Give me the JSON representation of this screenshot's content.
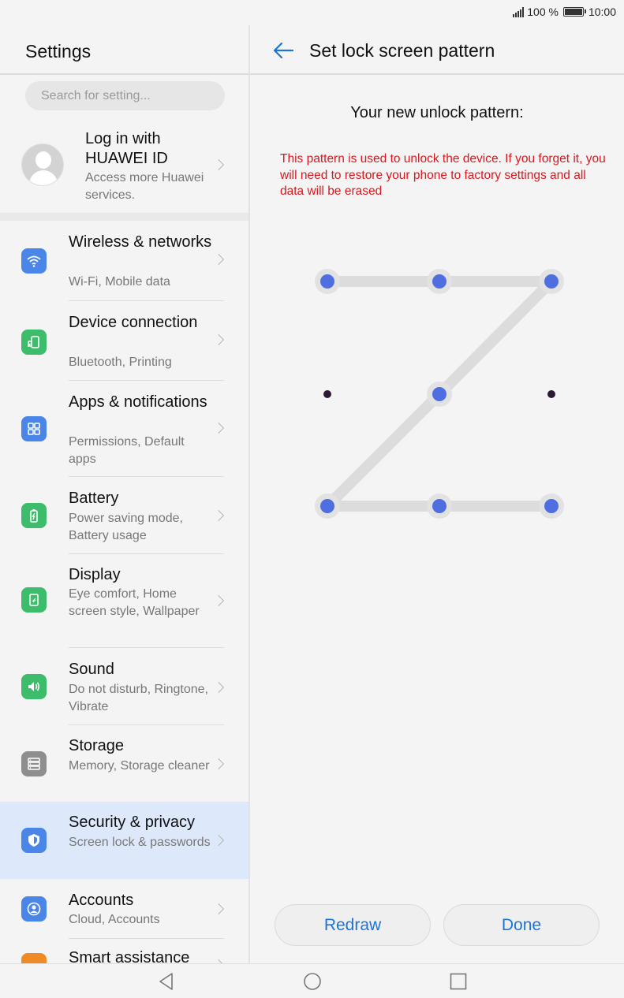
{
  "status_bar": {
    "battery_percent": "100 %",
    "time": "10:00"
  },
  "left": {
    "title": "Settings",
    "search_placeholder": "Search for setting...",
    "account": {
      "title": "Log in with HUAWEI ID",
      "subtitle": "Access more Huawei services."
    },
    "items": [
      {
        "title": "Wireless & networks",
        "subtitle": "Wi-Fi, Mobile data",
        "icon": "wifi-icon",
        "color": "#4a86e8"
      },
      {
        "title": "Device connection",
        "subtitle": "Bluetooth, Printing",
        "icon": "device-connection-icon",
        "color": "#3dbd6b"
      },
      {
        "title": "Apps & notifications",
        "subtitle": "Permissions, Default apps",
        "icon": "apps-grid-icon",
        "color": "#4a86e8"
      },
      {
        "title": "Battery",
        "subtitle": "Power saving mode, Battery usage",
        "icon": "battery-icon",
        "color": "#3dbd6b"
      },
      {
        "title": "Display",
        "subtitle": "Eye comfort, Home screen style, Wallpaper",
        "icon": "display-icon",
        "color": "#3dbd6b"
      },
      {
        "title": "Sound",
        "subtitle": "Do not disturb, Ringtone, Vibrate",
        "icon": "sound-icon",
        "color": "#3dbd6b"
      },
      {
        "title": "Storage",
        "subtitle": "Memory, Storage cleaner",
        "icon": "storage-icon",
        "color": "#8e8e8e"
      },
      {
        "title": "Security & privacy",
        "subtitle": "Screen lock & passwords",
        "icon": "shield-icon",
        "color": "#4a86e8"
      },
      {
        "title": "Accounts",
        "subtitle": "Cloud, Accounts",
        "icon": "account-icon",
        "color": "#4a86e8"
      },
      {
        "title": "Smart assistance",
        "subtitle": "",
        "icon": "smart-assistance-icon",
        "color": "#f08a24"
      }
    ]
  },
  "right": {
    "title": "Set lock screen pattern",
    "prompt": "Your new unlock pattern:",
    "warning": "This pattern is used to unlock the device. If you forget it, you will need to restore your phone to factory settings and all data will be erased",
    "pattern_sequence": [
      1,
      2,
      3,
      5,
      7,
      8,
      9
    ],
    "redraw_label": "Redraw",
    "done_label": "Done"
  },
  "colors": {
    "accent": "#1e74d6",
    "warning": "#d6191f",
    "dot_selected": "#4f6fe0",
    "selection_highlight": "#dde9fb"
  }
}
